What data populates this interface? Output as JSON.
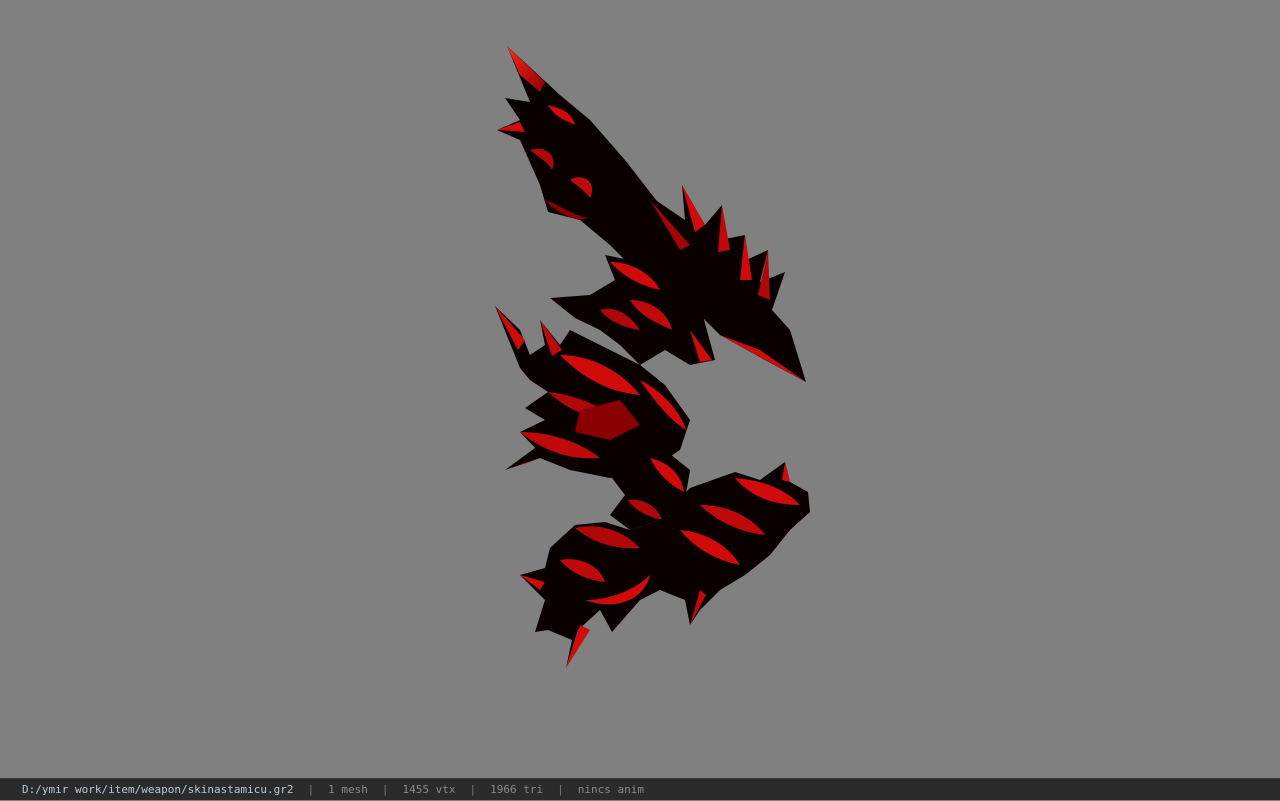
{
  "viewer": {
    "background": "#808080",
    "model": {
      "icon": "red-black-dragon-weapon-model",
      "colors": {
        "body": "#0a0000",
        "accent": "#d10a0a",
        "highlight": "#ff2a1a"
      }
    }
  },
  "statusbar": {
    "file_path": "D:/ymir work/item/weapon/skinastamicu.gr2",
    "separator": "|",
    "mesh_count": "1 mesh",
    "vertex_count": "1455 vtx",
    "triangle_count": "1966 tri",
    "animation": "nincs anim"
  }
}
